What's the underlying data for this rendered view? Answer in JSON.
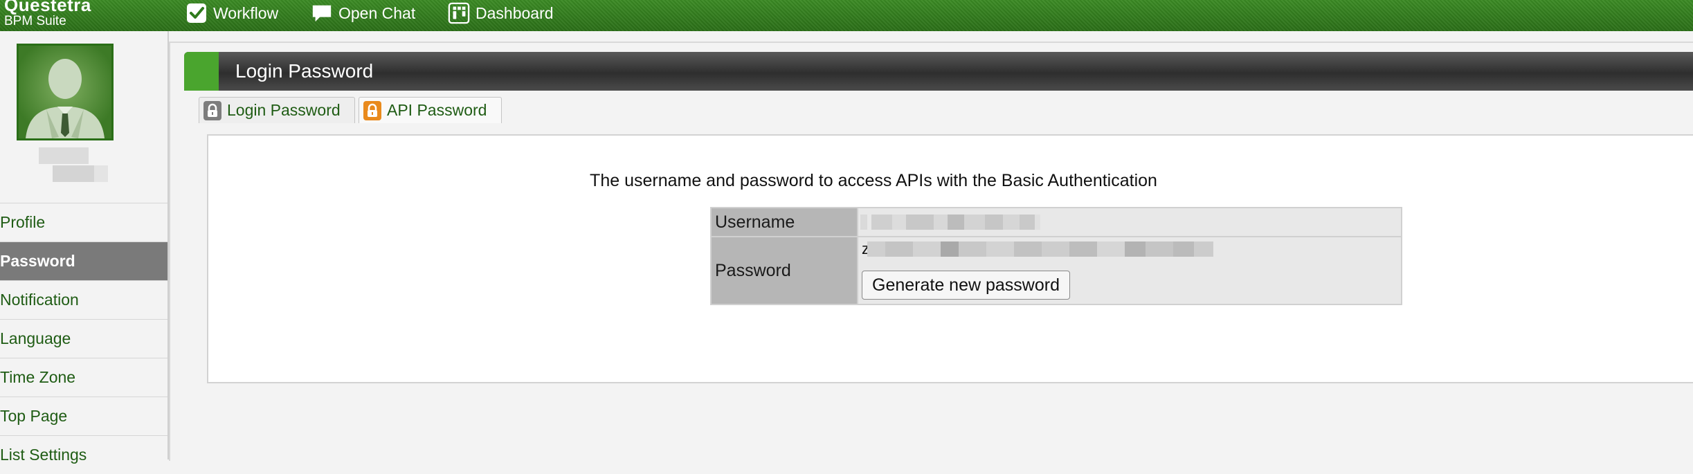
{
  "app": {
    "logo_line1": "Questetra",
    "logo_line2": "BPM Suite"
  },
  "nav": {
    "workflow": "Workflow",
    "open_chat": "Open Chat",
    "dashboard": "Dashboard"
  },
  "sidebar": {
    "items": [
      {
        "label": "Profile"
      },
      {
        "label": "Password"
      },
      {
        "label": "Notification"
      },
      {
        "label": "Language"
      },
      {
        "label": "Time Zone"
      },
      {
        "label": "Top Page"
      },
      {
        "label": "List Settings"
      }
    ]
  },
  "page": {
    "title": "Login Password",
    "tabs": [
      {
        "label": "Login Password"
      },
      {
        "label": "API Password"
      }
    ],
    "description": "The username and password to access APIs with the Basic Authentication",
    "username_label": "Username",
    "password_label": "Password",
    "password_prefix": "z",
    "generate_button": "Generate new password"
  },
  "colors": {
    "brand_green": "#2f7a1c",
    "link_green": "#1f5c14",
    "active_menu_bg": "#7a7a7a"
  },
  "icons": {
    "workflow": "checkbox-icon",
    "open_chat": "chat-bubble-icon",
    "dashboard": "dashboard-icon",
    "login_tab": "lock-icon",
    "api_tab": "lock-icon"
  }
}
